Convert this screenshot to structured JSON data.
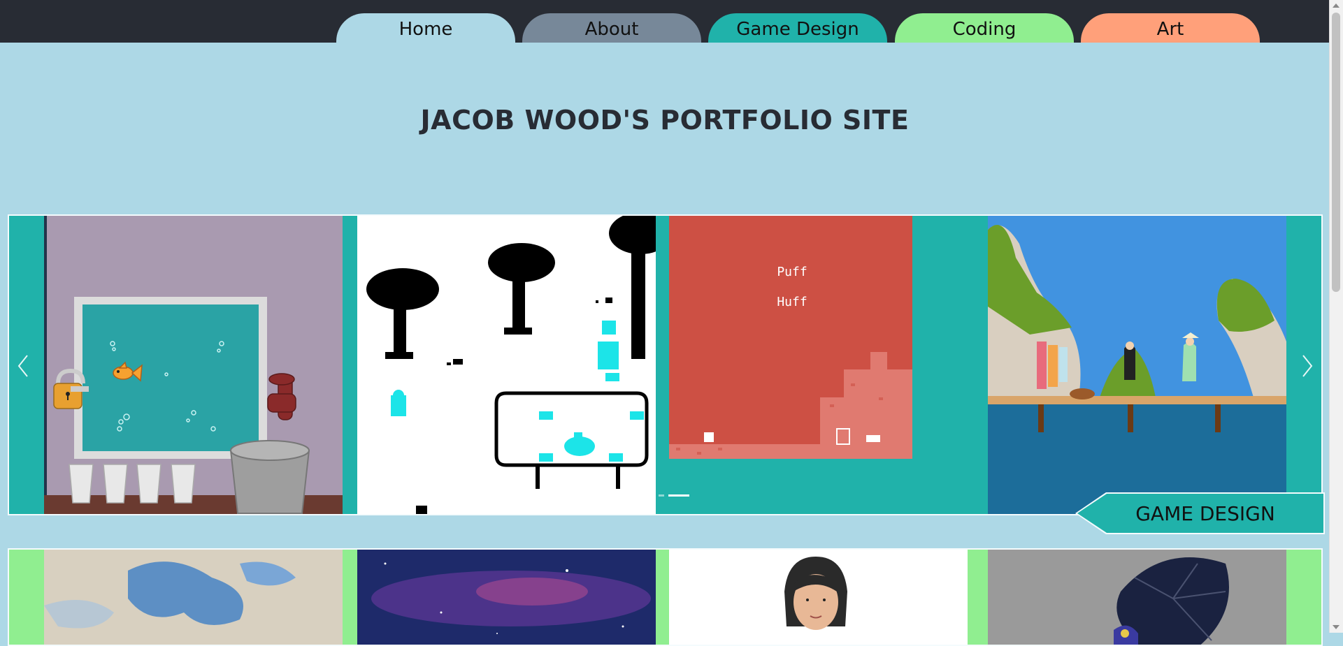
{
  "nav": {
    "tabs": [
      {
        "label": "Home",
        "color": "#add8e6"
      },
      {
        "label": "About",
        "color": "#778899"
      },
      {
        "label": "Game Design",
        "color": "#20b2aa"
      },
      {
        "label": "Coding",
        "color": "#90ee90"
      },
      {
        "label": "Art",
        "color": "#ffa07a"
      }
    ]
  },
  "page": {
    "title": "JACOB WOOD'S PORTFOLIO SITE"
  },
  "game_carousel": {
    "accent": "#20b2aa",
    "label": "GAME DESIGN",
    "puzzle_text": [
      "Puff",
      "Huff"
    ],
    "prev_icon": "chevron-left-icon",
    "next_icon": "chevron-right-icon"
  },
  "art_carousel": {
    "accent": "#90ee90"
  },
  "colors": {
    "topbar": "#282c34",
    "background": "#add8e6"
  }
}
